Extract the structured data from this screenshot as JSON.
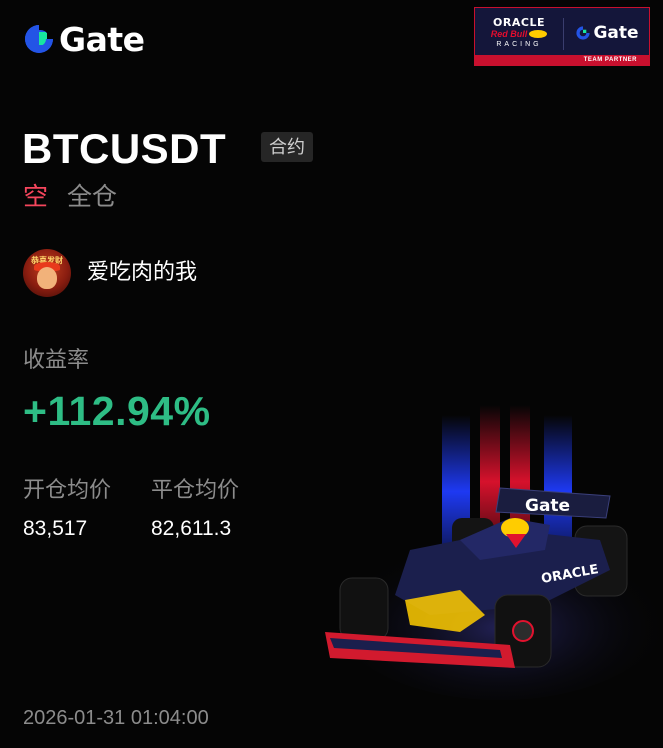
{
  "brand": {
    "name": "Gate",
    "accent": "#2354e6",
    "accent_light": "#17e6a1"
  },
  "partner_badge": {
    "oracle": "ORACLE",
    "redbull": "Red Bull",
    "racing": "RACING",
    "partner_brand": "Gate",
    "team_partner": "TEAM PARTNER"
  },
  "car": {
    "livery_text": "Gate",
    "sponsor_text": "ORACLE"
  },
  "position": {
    "symbol": "BTCUSDT",
    "contract_tag": "合约",
    "direction": "空",
    "margin_mode": "全仓",
    "direction_color": "#f6465d"
  },
  "user": {
    "name": "爱吃肉的我",
    "avatar_text": "恭喜发财"
  },
  "roi": {
    "label": "收益率",
    "value": "+112.94%",
    "color": "#2ebd85"
  },
  "prices": {
    "open_label": "开仓均价",
    "open_value": "83,517",
    "close_label": "平仓均价",
    "close_value": "82,611.3"
  },
  "timestamp": "2026-01-31 01:04:00"
}
